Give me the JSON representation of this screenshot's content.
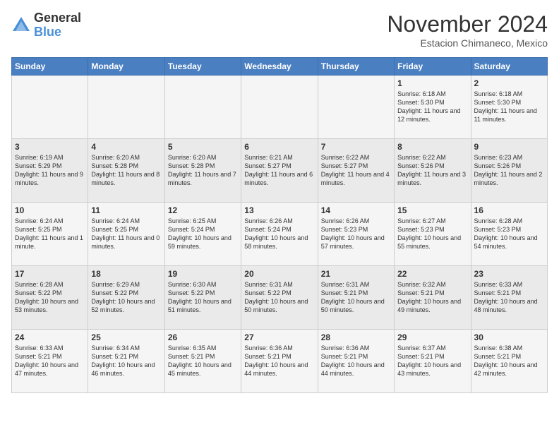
{
  "header": {
    "logo_general": "General",
    "logo_blue": "Blue",
    "month_title": "November 2024",
    "location": "Estacion Chimaneco, Mexico"
  },
  "days_of_week": [
    "Sunday",
    "Monday",
    "Tuesday",
    "Wednesday",
    "Thursday",
    "Friday",
    "Saturday"
  ],
  "weeks": [
    [
      {
        "day": "",
        "info": ""
      },
      {
        "day": "",
        "info": ""
      },
      {
        "day": "",
        "info": ""
      },
      {
        "day": "",
        "info": ""
      },
      {
        "day": "",
        "info": ""
      },
      {
        "day": "1",
        "info": "Sunrise: 6:18 AM\nSunset: 5:30 PM\nDaylight: 11 hours and 12 minutes."
      },
      {
        "day": "2",
        "info": "Sunrise: 6:18 AM\nSunset: 5:30 PM\nDaylight: 11 hours and 11 minutes."
      }
    ],
    [
      {
        "day": "3",
        "info": "Sunrise: 6:19 AM\nSunset: 5:29 PM\nDaylight: 11 hours and 9 minutes."
      },
      {
        "day": "4",
        "info": "Sunrise: 6:20 AM\nSunset: 5:28 PM\nDaylight: 11 hours and 8 minutes."
      },
      {
        "day": "5",
        "info": "Sunrise: 6:20 AM\nSunset: 5:28 PM\nDaylight: 11 hours and 7 minutes."
      },
      {
        "day": "6",
        "info": "Sunrise: 6:21 AM\nSunset: 5:27 PM\nDaylight: 11 hours and 6 minutes."
      },
      {
        "day": "7",
        "info": "Sunrise: 6:22 AM\nSunset: 5:27 PM\nDaylight: 11 hours and 4 minutes."
      },
      {
        "day": "8",
        "info": "Sunrise: 6:22 AM\nSunset: 5:26 PM\nDaylight: 11 hours and 3 minutes."
      },
      {
        "day": "9",
        "info": "Sunrise: 6:23 AM\nSunset: 5:26 PM\nDaylight: 11 hours and 2 minutes."
      }
    ],
    [
      {
        "day": "10",
        "info": "Sunrise: 6:24 AM\nSunset: 5:25 PM\nDaylight: 11 hours and 1 minute."
      },
      {
        "day": "11",
        "info": "Sunrise: 6:24 AM\nSunset: 5:25 PM\nDaylight: 11 hours and 0 minutes."
      },
      {
        "day": "12",
        "info": "Sunrise: 6:25 AM\nSunset: 5:24 PM\nDaylight: 10 hours and 59 minutes."
      },
      {
        "day": "13",
        "info": "Sunrise: 6:26 AM\nSunset: 5:24 PM\nDaylight: 10 hours and 58 minutes."
      },
      {
        "day": "14",
        "info": "Sunrise: 6:26 AM\nSunset: 5:23 PM\nDaylight: 10 hours and 57 minutes."
      },
      {
        "day": "15",
        "info": "Sunrise: 6:27 AM\nSunset: 5:23 PM\nDaylight: 10 hours and 55 minutes."
      },
      {
        "day": "16",
        "info": "Sunrise: 6:28 AM\nSunset: 5:23 PM\nDaylight: 10 hours and 54 minutes."
      }
    ],
    [
      {
        "day": "17",
        "info": "Sunrise: 6:28 AM\nSunset: 5:22 PM\nDaylight: 10 hours and 53 minutes."
      },
      {
        "day": "18",
        "info": "Sunrise: 6:29 AM\nSunset: 5:22 PM\nDaylight: 10 hours and 52 minutes."
      },
      {
        "day": "19",
        "info": "Sunrise: 6:30 AM\nSunset: 5:22 PM\nDaylight: 10 hours and 51 minutes."
      },
      {
        "day": "20",
        "info": "Sunrise: 6:31 AM\nSunset: 5:22 PM\nDaylight: 10 hours and 50 minutes."
      },
      {
        "day": "21",
        "info": "Sunrise: 6:31 AM\nSunset: 5:21 PM\nDaylight: 10 hours and 50 minutes."
      },
      {
        "day": "22",
        "info": "Sunrise: 6:32 AM\nSunset: 5:21 PM\nDaylight: 10 hours and 49 minutes."
      },
      {
        "day": "23",
        "info": "Sunrise: 6:33 AM\nSunset: 5:21 PM\nDaylight: 10 hours and 48 minutes."
      }
    ],
    [
      {
        "day": "24",
        "info": "Sunrise: 6:33 AM\nSunset: 5:21 PM\nDaylight: 10 hours and 47 minutes."
      },
      {
        "day": "25",
        "info": "Sunrise: 6:34 AM\nSunset: 5:21 PM\nDaylight: 10 hours and 46 minutes."
      },
      {
        "day": "26",
        "info": "Sunrise: 6:35 AM\nSunset: 5:21 PM\nDaylight: 10 hours and 45 minutes."
      },
      {
        "day": "27",
        "info": "Sunrise: 6:36 AM\nSunset: 5:21 PM\nDaylight: 10 hours and 44 minutes."
      },
      {
        "day": "28",
        "info": "Sunrise: 6:36 AM\nSunset: 5:21 PM\nDaylight: 10 hours and 44 minutes."
      },
      {
        "day": "29",
        "info": "Sunrise: 6:37 AM\nSunset: 5:21 PM\nDaylight: 10 hours and 43 minutes."
      },
      {
        "day": "30",
        "info": "Sunrise: 6:38 AM\nSunset: 5:21 PM\nDaylight: 10 hours and 42 minutes."
      }
    ]
  ]
}
